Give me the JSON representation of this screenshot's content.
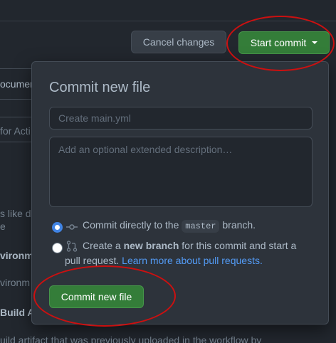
{
  "header": {
    "cancel_label": "Cancel changes",
    "start_commit_label": "Start commit"
  },
  "background": {
    "docs_fragment": "ocumen",
    "actions_fragment": "for Acti",
    "like_fragment": "s like d",
    "e_fragment": "e",
    "environment_heading": "vironm",
    "environment_text": "vironm",
    "build_heading": "Build A",
    "artifact_text": "uild artifact that was previously uploaded in the workflow by"
  },
  "popover": {
    "title": "Commit new file",
    "summary_placeholder": "Create main.yml",
    "description_placeholder": "Add an optional extended description…",
    "option_direct": {
      "prefix": "Commit directly to the",
      "branch": "master",
      "suffix": "branch."
    },
    "option_new": {
      "prefix": "Create a",
      "bold": "new branch",
      "suffix": "for this commit and start a",
      "line2": "pull request.",
      "link": "Learn more about pull requests."
    },
    "commit_label": "Commit new file"
  },
  "colors": {
    "background": "#22272e",
    "primary_button": "#347d39",
    "annotation": "#cc1010",
    "link": "#539bf5"
  }
}
